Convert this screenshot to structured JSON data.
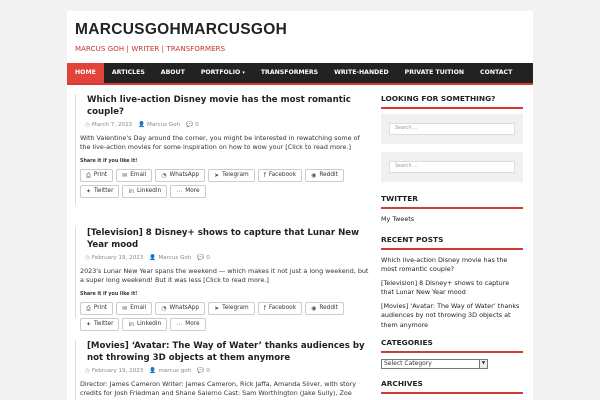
{
  "site": {
    "title": "MARCUSGOHMARCUSGOH",
    "tagline": "MARCUS GOH | WRITER | TRANSFORMERS"
  },
  "nav": {
    "items": [
      {
        "label": "HOME",
        "active": true
      },
      {
        "label": "ARTICLES"
      },
      {
        "label": "ABOUT"
      },
      {
        "label": "PORTFOLIO",
        "dropdown": true
      },
      {
        "label": "TRANSFORMERS"
      },
      {
        "label": "WRITE-HANDED"
      },
      {
        "label": "PRIVATE TUITION"
      },
      {
        "label": "CONTACT"
      }
    ]
  },
  "posts": [
    {
      "title": "Which live-action Disney movie has the most romantic couple?",
      "date": "March 7, 2023",
      "author": "Marcus Goh",
      "comments": "0",
      "excerpt": "With Valentine's Day around the corner, you might be interested in rewatching some of the live-action movies for some inspiration on how to wow your [Click to read more.]",
      "share_label": "Share it if you like it!"
    },
    {
      "title": "[Television] 8 Disney+ shows to capture that Lunar New Year mood",
      "date": "February 19, 2023",
      "author": "Marcus Goh",
      "comments": "0",
      "excerpt": "2023's Lunar New Year spans the weekend — which makes it not just a long weekend, but a super long weekend! But it was less [Click to read more.]",
      "share_label": "Share it if you like it!"
    },
    {
      "title": "[Movies] ‘Avatar: The Way of Water’ thanks audiences by not throwing 3D objects at them anymore",
      "date": "February 19, 2023",
      "author": "marcus goh",
      "comments": "0",
      "excerpt": "Director: James Cameron Writer: James Cameron, Rick Jaffa, Amanda Silver, with story credits for Josh Friedman and Shane Salerno Cast: Sam Worthington (Jake Sully), Zoe [Click to read more.]"
    }
  ],
  "share_buttons": [
    {
      "icon": "print-icon",
      "glyph": "⎙",
      "label": "Print"
    },
    {
      "icon": "email-icon",
      "glyph": "✉",
      "label": "Email"
    },
    {
      "icon": "whatsapp-icon",
      "glyph": "◔",
      "label": "WhatsApp"
    },
    {
      "icon": "telegram-icon",
      "glyph": "➤",
      "label": "Telegram"
    },
    {
      "icon": "facebook-icon",
      "glyph": "f",
      "label": "Facebook"
    },
    {
      "icon": "reddit-icon",
      "glyph": "◉",
      "label": "Reddit"
    },
    {
      "icon": "twitter-icon",
      "glyph": "✦",
      "label": "Twitter"
    },
    {
      "icon": "linkedin-icon",
      "glyph": "in",
      "label": "LinkedIn"
    },
    {
      "icon": "more-icon",
      "glyph": "⋯",
      "label": "More"
    }
  ],
  "sidebar": {
    "search_title": "LOOKING FOR SOMETHING?",
    "search_placeholder": "Search ...",
    "search2_placeholder": "Search ...",
    "twitter_title": "TWITTER",
    "twitter_link": "My Tweets",
    "recent_title": "RECENT POSTS",
    "recent": [
      "Which live-action Disney movie has the most romantic couple?",
      "[Television] 8 Disney+ shows to capture that Lunar New Year mood",
      "[Movies] ‘Avatar: The Way of Water’ thanks audiences by not throwing 3D objects at them anymore"
    ],
    "categories_title": "CATEGORIES",
    "categories_select": "Select Category",
    "archives_title": "ARCHIVES"
  },
  "colors": {
    "accent": "#d43a33",
    "nav_bg": "#222222",
    "active_nav": "#e0443a"
  }
}
